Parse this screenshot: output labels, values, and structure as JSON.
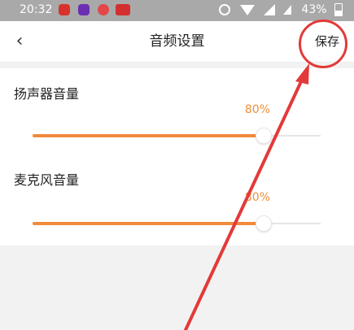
{
  "status_bar": {
    "time": "20:32",
    "battery": "43%"
  },
  "header": {
    "back_icon": "‹",
    "title": "音频设置",
    "save_label": "保存"
  },
  "settings": [
    {
      "label": "扬声器音量",
      "value_text": "80%",
      "value": 0.8
    },
    {
      "label": "麦克风音量",
      "value_text": "80%",
      "value": 0.8
    }
  ],
  "colors": {
    "accent": "#f08a3c",
    "annotation": "#e23a3a"
  }
}
